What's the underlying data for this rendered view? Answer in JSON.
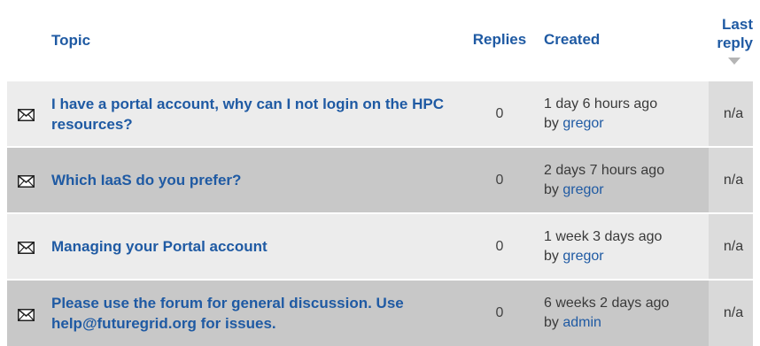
{
  "header": {
    "topic": "Topic",
    "replies": "Replies",
    "created": "Created",
    "last_reply_line1": "Last",
    "last_reply_line2": "reply"
  },
  "icons": {
    "row_icon": "envelope-icon",
    "sort_icon": "sort-descending-arrow-icon"
  },
  "colors": {
    "link": "#1f5aa3",
    "row_light": "#ececec",
    "row_dark": "#c8c8c8"
  },
  "topics": [
    {
      "title": "I have a portal account, why can I not login on the HPC resources?",
      "replies": "0",
      "created": "1 day 6 hours ago",
      "by_prefix": "by",
      "author": "gregor",
      "last_reply": "n/a"
    },
    {
      "title": "Which IaaS do you prefer?",
      "replies": "0",
      "created": "2 days 7 hours ago",
      "by_prefix": "by",
      "author": "gregor",
      "last_reply": "n/a"
    },
    {
      "title": "Managing your Portal account",
      "replies": "0",
      "created": "1 week 3 days ago",
      "by_prefix": "by",
      "author": "gregor",
      "last_reply": "n/a"
    },
    {
      "title": "Please use the forum for general discussion. Use help@futuregrid.org for issues.",
      "replies": "0",
      "created": "6 weeks 2 days ago",
      "by_prefix": "by",
      "author": "admin",
      "last_reply": "n/a"
    }
  ]
}
